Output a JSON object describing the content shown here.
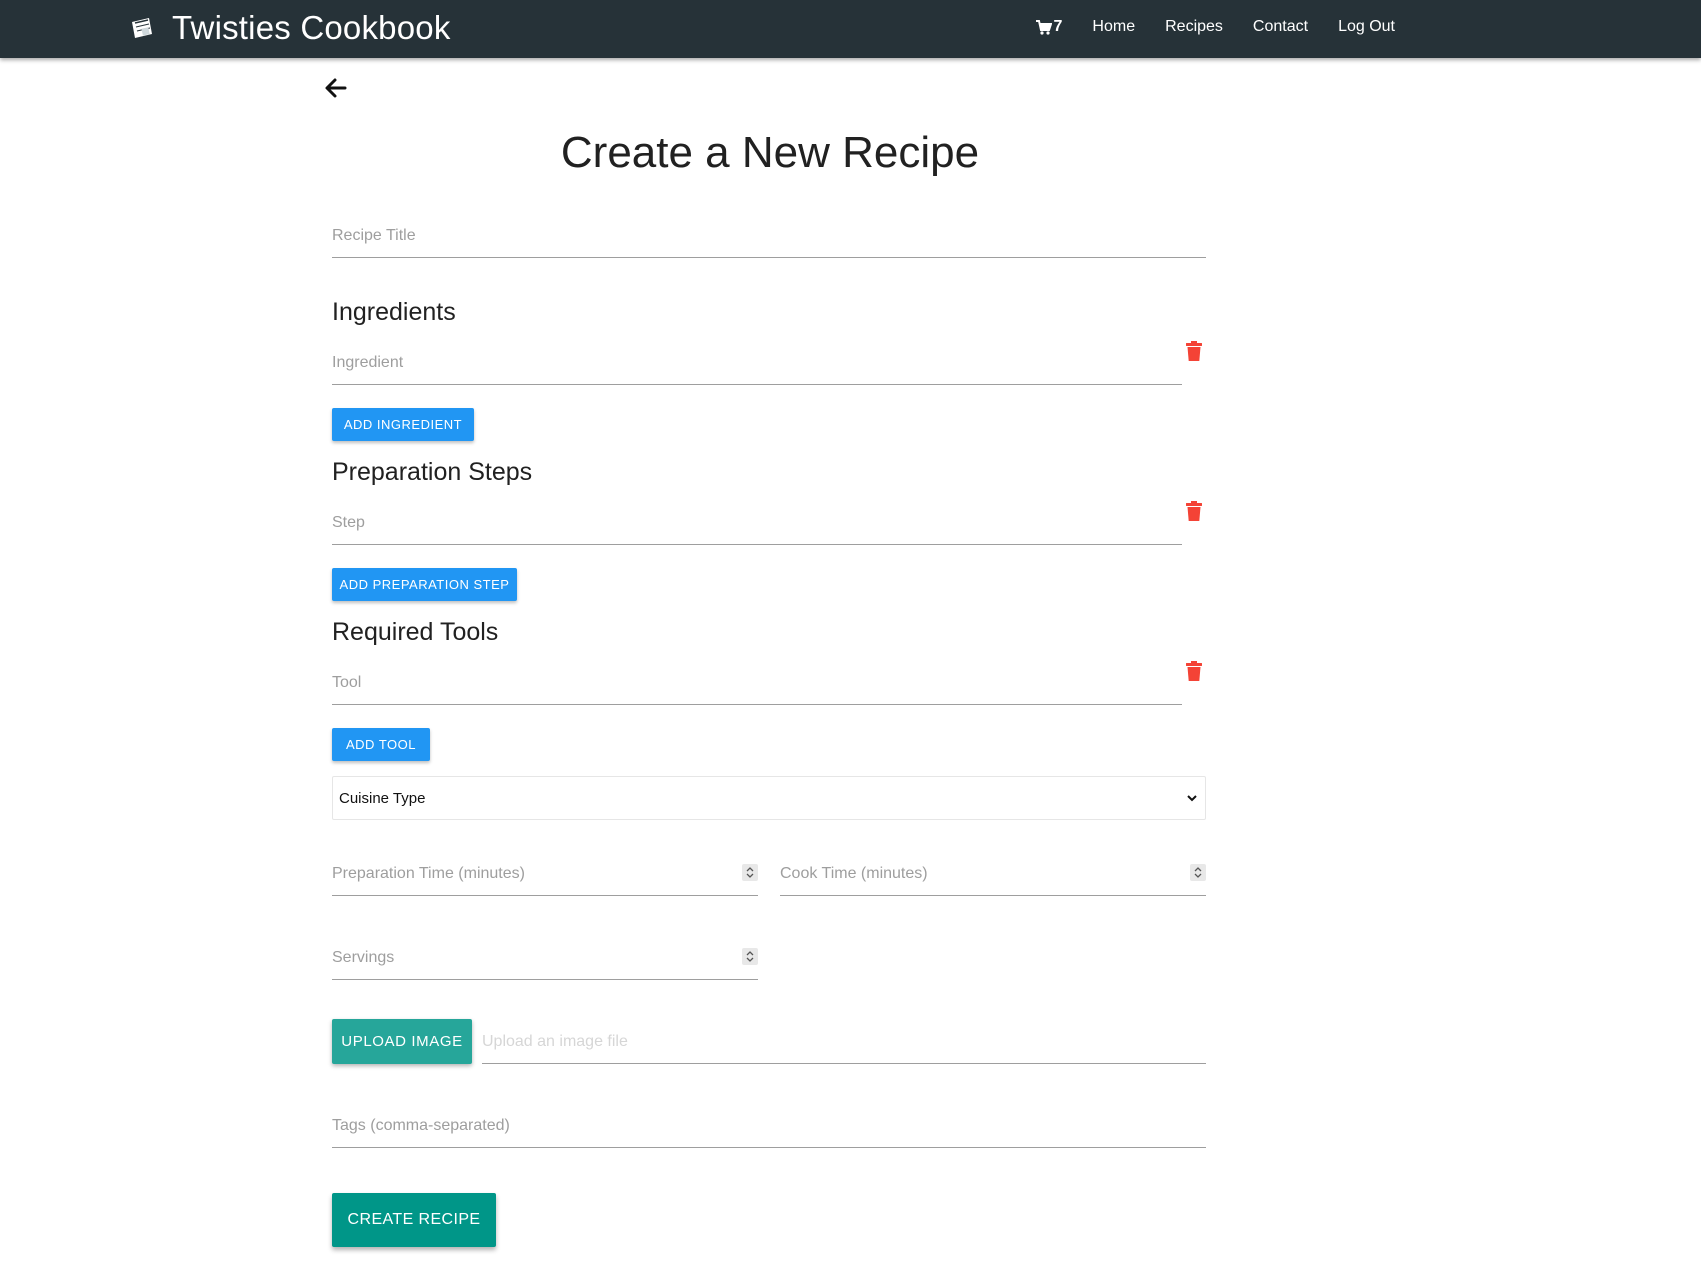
{
  "header": {
    "brand": "Twisties Cookbook",
    "cart_count": "7",
    "nav": [
      "Home",
      "Recipes",
      "Contact",
      "Log Out"
    ]
  },
  "page_title": "Create a New Recipe",
  "form": {
    "recipe_title_placeholder": "Recipe Title",
    "ingredients": {
      "heading": "Ingredients",
      "placeholder": "Ingredient",
      "add_label": "ADD INGREDIENT"
    },
    "steps": {
      "heading": "Preparation Steps",
      "placeholder": "Step",
      "add_label": "ADD PREPARATION STEP"
    },
    "tools": {
      "heading": "Required Tools",
      "placeholder": "Tool",
      "add_label": "ADD TOOL"
    },
    "cuisine_select": "Cuisine Type",
    "prep_time_placeholder": "Preparation Time (minutes)",
    "cook_time_placeholder": "Cook Time (minutes)",
    "servings_placeholder": "Servings",
    "upload_label": "UPLOAD IMAGE",
    "upload_placeholder": "Upload an image file",
    "tags_placeholder": "Tags (comma-separated)",
    "submit_label": "CREATE RECIPE"
  },
  "colors": {
    "navbar": "#263238",
    "primary_button": "#2196f3",
    "upload_button": "#26a69a",
    "submit_button": "#009688",
    "delete_icon": "#f44336"
  }
}
